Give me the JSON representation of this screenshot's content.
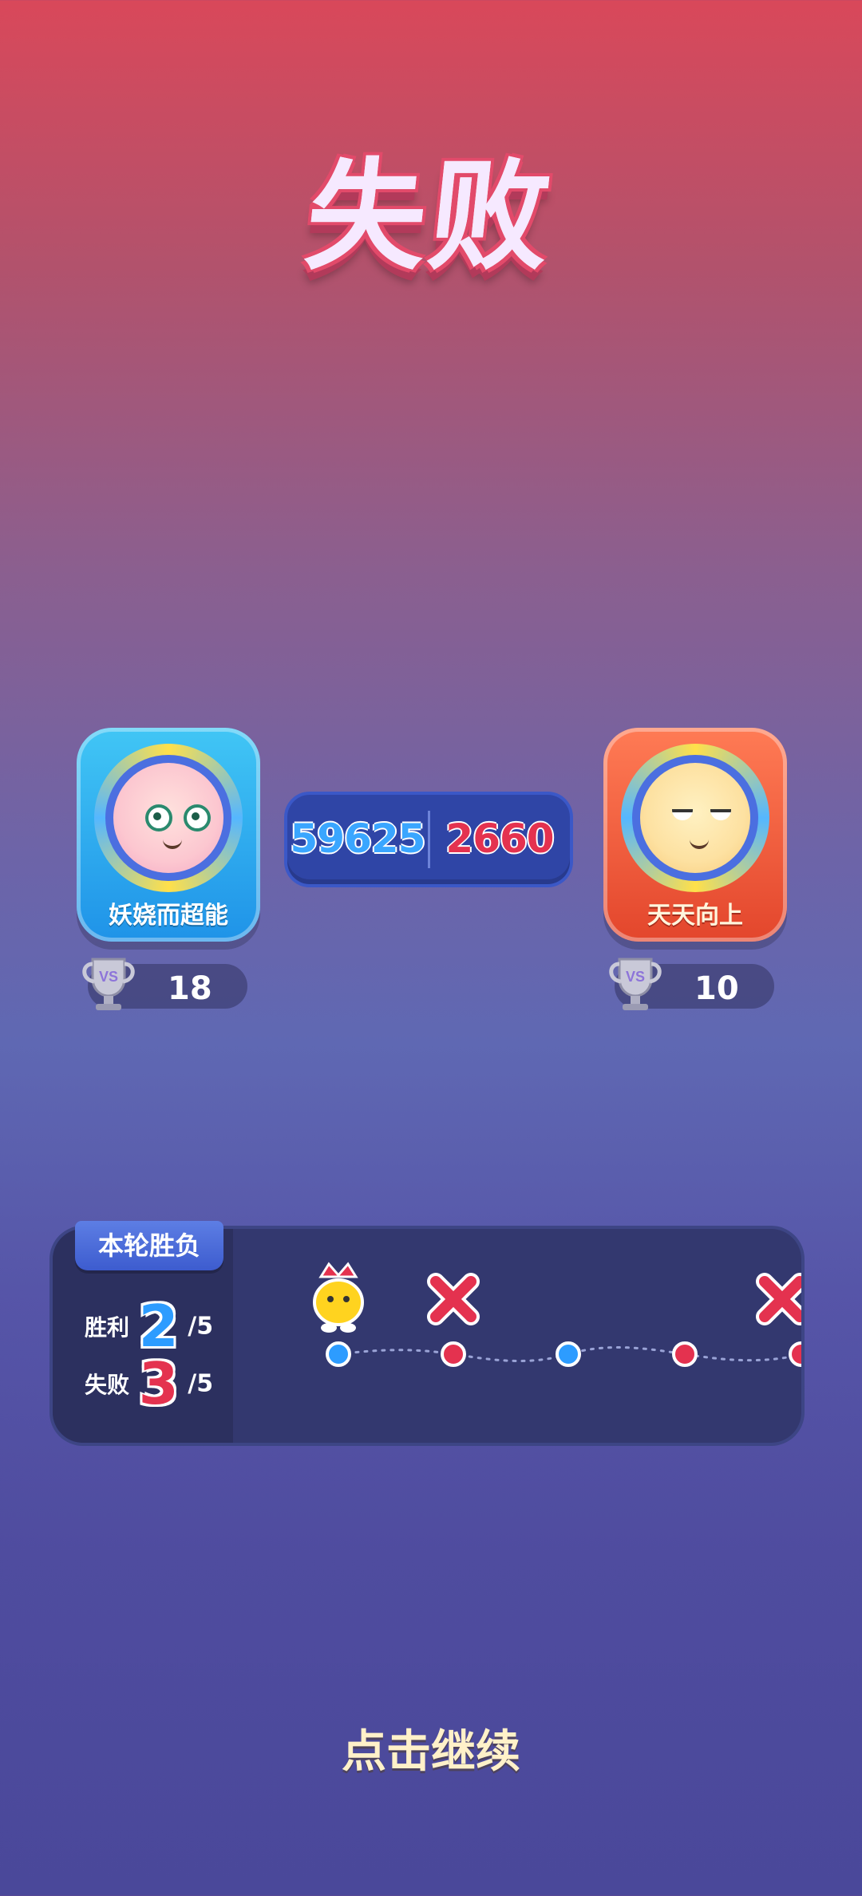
{
  "result": {
    "title": "失败"
  },
  "players": [
    {
      "name": "妖娆而超能",
      "trophy_count": "18",
      "score": "59625",
      "team_color": "#2d9cff"
    },
    {
      "name": "天天向上",
      "trophy_count": "10",
      "score": "2660",
      "team_color": "#e4324f"
    }
  ],
  "round_panel": {
    "tab_label": "本轮胜负",
    "wins_label": "胜利",
    "wins": "2",
    "wins_total": "/5",
    "losses_label": "失败",
    "losses": "3",
    "losses_total": "/5",
    "rounds": [
      {
        "result": "win",
        "marker": "mascot"
      },
      {
        "result": "lose",
        "marker": "x"
      },
      {
        "result": "win",
        "marker": "none"
      },
      {
        "result": "lose",
        "marker": "none"
      },
      {
        "result": "lose",
        "marker": "x"
      }
    ]
  },
  "continue_label": "点击继续"
}
